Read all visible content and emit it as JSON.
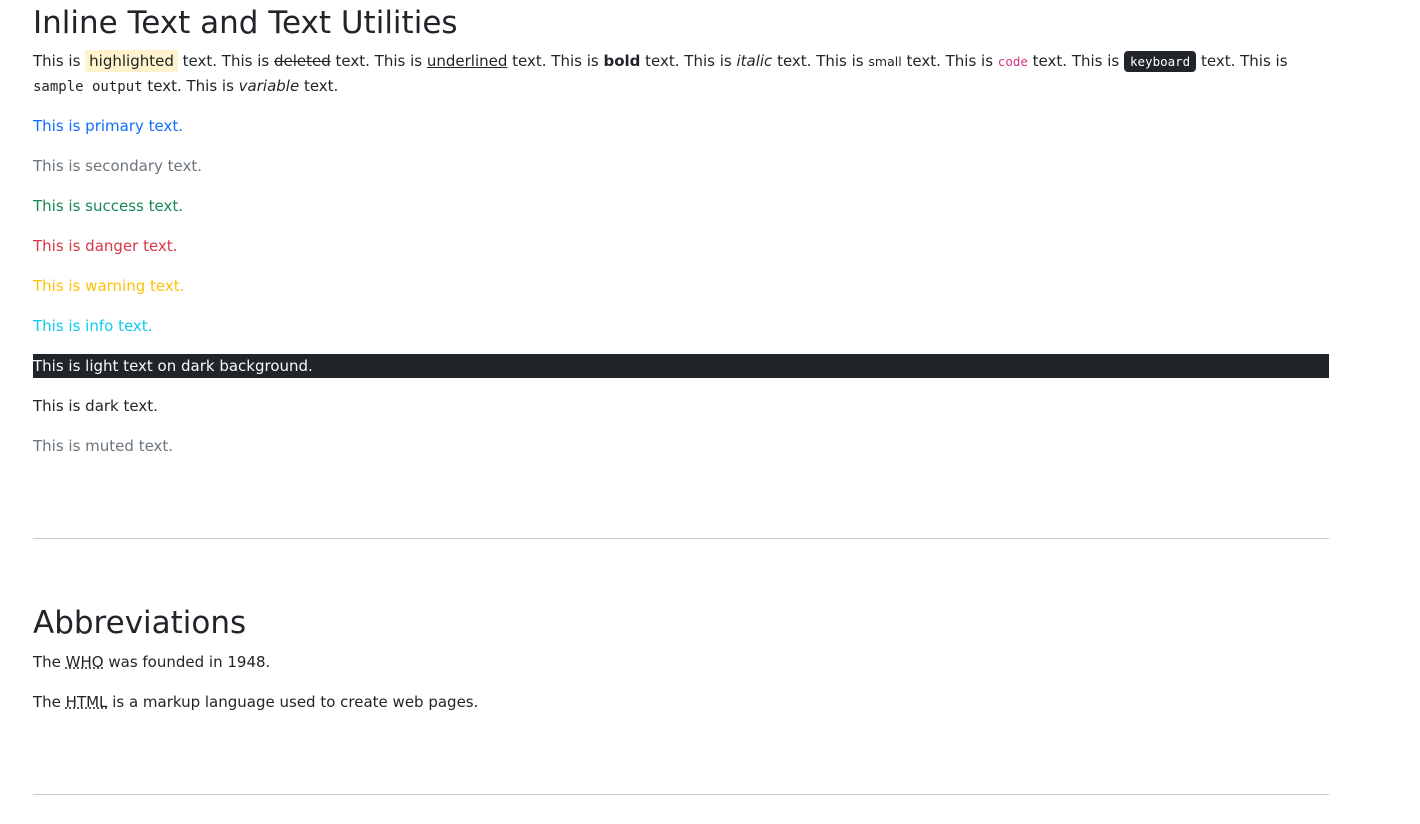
{
  "section1": {
    "title": "Inline Text and Text Utilities",
    "inline": {
      "t1": "This is ",
      "highlighted": "highlighted",
      "t2": " text. This is ",
      "deleted": "deleted",
      "t3": " text. This is ",
      "underlined": "underlined",
      "t4": " text. This is ",
      "bold": "bold",
      "t5": " text. This is ",
      "italic": "italic",
      "t6": " text. This is ",
      "small": "small",
      "t7": " text. This is ",
      "code": "code",
      "t8": " text. This is ",
      "keyboard": "keyboard",
      "t9": " text. This is ",
      "sample": "sample output",
      "t10": " text. This is ",
      "variable": "variable",
      "t11": " text."
    },
    "colors": {
      "primary": "This is primary text.",
      "secondary": "This is secondary text.",
      "success": "This is success text.",
      "danger": "This is danger text.",
      "warning": "This is warning text.",
      "info": "This is info text.",
      "light_on_dark": "This is light text on dark background.",
      "dark": "This is dark text.",
      "muted": "This is muted text."
    }
  },
  "section2": {
    "title": "Abbreviations",
    "line1": {
      "pre": "The ",
      "abbr": "WHO",
      "post": " was founded in 1948."
    },
    "line2": {
      "pre": "The ",
      "abbr": "HTML",
      "post": " is a markup language used to create web pages."
    }
  },
  "theme": {
    "primary": "#0d6efd",
    "secondary": "#6c757d",
    "success": "#198754",
    "danger": "#dc3545",
    "warning": "#ffc107",
    "info": "#0dcaf0",
    "dark": "#212529",
    "highlight": "#fff3cd",
    "code": "#d63384"
  }
}
